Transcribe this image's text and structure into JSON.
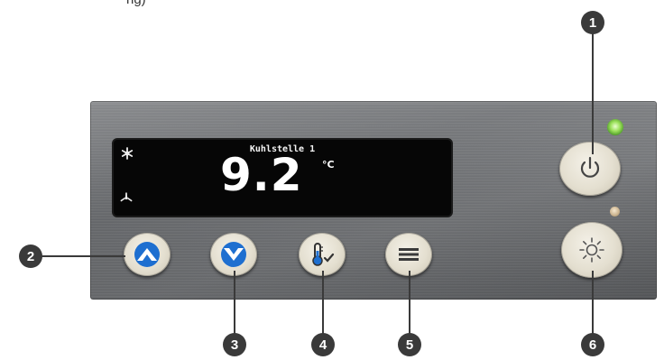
{
  "header": {
    "partial_text": "ng)"
  },
  "display": {
    "title": "Kuhlstelle 1",
    "temperature": "9.2",
    "unit": "°C",
    "icons": [
      "snowflake-icon",
      "fan-icon"
    ]
  },
  "buttons": [
    {
      "id": "up",
      "icon": "chevron-up-icon"
    },
    {
      "id": "down",
      "icon": "chevron-down-icon"
    },
    {
      "id": "temp-confirm",
      "icon": "thermometer-check-icon"
    },
    {
      "id": "menu",
      "icon": "menu-icon"
    },
    {
      "id": "power",
      "icon": "power-icon"
    },
    {
      "id": "light",
      "icon": "light-icon"
    }
  ],
  "callouts": [
    "1",
    "2",
    "3",
    "4",
    "5",
    "6"
  ],
  "indicators": {
    "power_led": "green",
    "light_led": "amber"
  },
  "colors": {
    "accent": "#1e6fd0",
    "callout": "#3a3a3a",
    "display_bg": "#060606"
  }
}
